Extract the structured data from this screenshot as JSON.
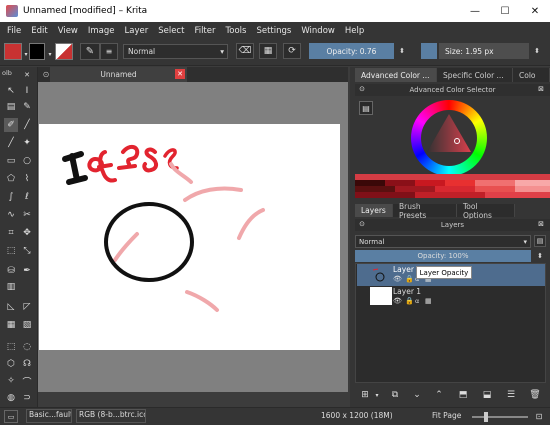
{
  "window": {
    "title": "Unnamed [modified] – Krita",
    "minimize": "—",
    "maximize": "☐",
    "close": "✕"
  },
  "menu": [
    "File",
    "Edit",
    "View",
    "Image",
    "Layer",
    "Select",
    "Filter",
    "Tools",
    "Settings",
    "Window",
    "Help"
  ],
  "toolbar": {
    "blend_mode": "Normal",
    "opacity_label": "Opacity:  0.76",
    "opacity_value": 0.76,
    "size_label": "Size:  1.95 px"
  },
  "canvas_tab": {
    "label": "Unnamed"
  },
  "left_dock_label": "olb",
  "colors": {
    "foreground": "#c83232",
    "accent": "#5a7fa3",
    "drawing_red": "#e2242f",
    "drawing_pink": "#f0a8ab"
  },
  "right_top_tabs": [
    "Advanced Color ...",
    "Specific Color ...",
    "Colo"
  ],
  "color_selector": {
    "title": "Advanced Color Selector"
  },
  "right_bottom_tabs": [
    "Layers",
    "Brush Presets",
    "Tool Options"
  ],
  "layers_panel": {
    "title": "Layers",
    "blend_mode": "Normal",
    "opacity_label": "Opacity:  100%",
    "layers": [
      {
        "name": "Layer 2",
        "selected": true
      },
      {
        "name": "Layer 1",
        "selected": false
      }
    ],
    "tooltip": "Layer Opacity"
  },
  "status": {
    "brush": "Basic...fault",
    "color_space": "RGB (8-b...btrc.icc",
    "doc_size": "1600 x 1200 (18M)",
    "fit": "Fit Page"
  }
}
